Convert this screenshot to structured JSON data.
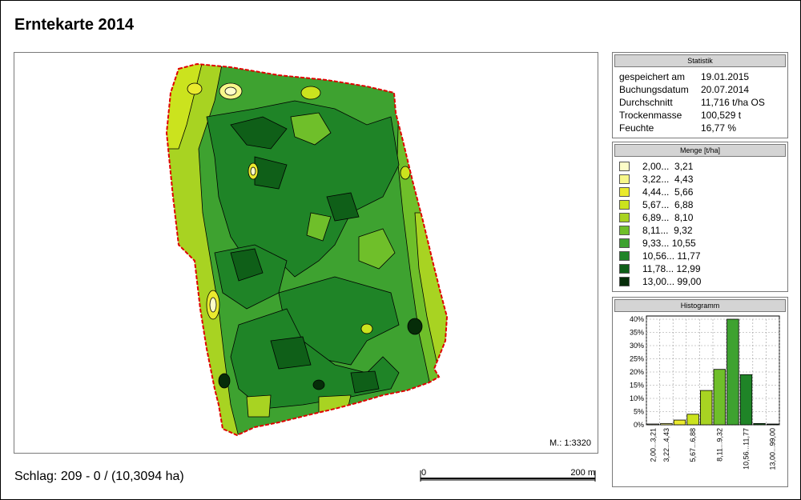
{
  "title": "Erntekarte 2014",
  "map": {
    "scale": "M.: 1:3320"
  },
  "schlag": "Schlag: 209 - 0 /  (10,3094 ha)",
  "scalebar": {
    "start": "0",
    "end": "200 m"
  },
  "statistik": {
    "header": "Statistik",
    "rows": [
      {
        "key": "gespeichert am",
        "value": "19.01.2015"
      },
      {
        "key": "Buchungsdatum",
        "value": "20.07.2014"
      },
      {
        "key": "Durchschnitt",
        "value": "11,716 t/ha OS"
      },
      {
        "key": "Trockenmasse",
        "value": "100,529 t"
      },
      {
        "key": "Feuchte",
        "value": "16,77 %"
      }
    ]
  },
  "menge": {
    "header": "Menge [t/ha]",
    "classes": [
      {
        "label": "2,00...  3,21",
        "color": "#fdfdc8"
      },
      {
        "label": "3,22...  4,43",
        "color": "#f7f78a"
      },
      {
        "label": "4,44...  5,66",
        "color": "#eaea2e"
      },
      {
        "label": "5,67...  6,88",
        "color": "#cbe31e"
      },
      {
        "label": "6,89...  8,10",
        "color": "#a8d322"
      },
      {
        "label": "8,11...  9,32",
        "color": "#6fbf2a"
      },
      {
        "label": "9,33... 10,55",
        "color": "#3ea230"
      },
      {
        "label": "10,56... 11,77",
        "color": "#1f8427"
      },
      {
        "label": "11,78... 12,99",
        "color": "#0f5f18"
      },
      {
        "label": "13,00... 99,00",
        "color": "#062d09"
      }
    ]
  },
  "histogramm": {
    "header": "Histogramm",
    "yticks": [
      "40%",
      "35%",
      "30%",
      "25%",
      "20%",
      "15%",
      "10%",
      "5%",
      "0%"
    ],
    "xticks": [
      "2,00...3,21",
      "3,22...4,43",
      "5,67...6,88",
      "8,11...9,32",
      "10,56...11,77",
      "13,00...99,00"
    ]
  },
  "chart_data": {
    "type": "bar",
    "categories": [
      "2,00...3,21",
      "3,22...4,43",
      "4,44...5,66",
      "5,67...6,88",
      "6,89...8,10",
      "8,11...9,32",
      "9,33...10,55",
      "10,56...11,77",
      "11,78...12,99",
      "13,00...99,00"
    ],
    "values": [
      0.3,
      0.5,
      1.8,
      4.0,
      13.0,
      21.0,
      40.0,
      19.0,
      0.5,
      0.3
    ],
    "ylim": [
      0,
      42
    ],
    "colors": [
      "#fdfdc8",
      "#f7f78a",
      "#eaea2e",
      "#cbe31e",
      "#a8d322",
      "#6fbf2a",
      "#3ea230",
      "#1f8427",
      "#0f5f18",
      "#062d09"
    ]
  }
}
